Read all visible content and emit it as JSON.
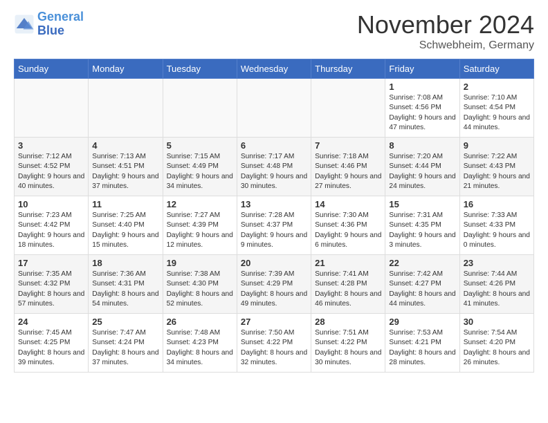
{
  "header": {
    "logo_line1": "General",
    "logo_line2": "Blue",
    "month_title": "November 2024",
    "location": "Schwebheim, Germany"
  },
  "weekdays": [
    "Sunday",
    "Monday",
    "Tuesday",
    "Wednesday",
    "Thursday",
    "Friday",
    "Saturday"
  ],
  "weeks": [
    [
      {
        "day": "",
        "info": ""
      },
      {
        "day": "",
        "info": ""
      },
      {
        "day": "",
        "info": ""
      },
      {
        "day": "",
        "info": ""
      },
      {
        "day": "",
        "info": ""
      },
      {
        "day": "1",
        "info": "Sunrise: 7:08 AM\nSunset: 4:56 PM\nDaylight: 9 hours and 47 minutes."
      },
      {
        "day": "2",
        "info": "Sunrise: 7:10 AM\nSunset: 4:54 PM\nDaylight: 9 hours and 44 minutes."
      }
    ],
    [
      {
        "day": "3",
        "info": "Sunrise: 7:12 AM\nSunset: 4:52 PM\nDaylight: 9 hours and 40 minutes."
      },
      {
        "day": "4",
        "info": "Sunrise: 7:13 AM\nSunset: 4:51 PM\nDaylight: 9 hours and 37 minutes."
      },
      {
        "day": "5",
        "info": "Sunrise: 7:15 AM\nSunset: 4:49 PM\nDaylight: 9 hours and 34 minutes."
      },
      {
        "day": "6",
        "info": "Sunrise: 7:17 AM\nSunset: 4:48 PM\nDaylight: 9 hours and 30 minutes."
      },
      {
        "day": "7",
        "info": "Sunrise: 7:18 AM\nSunset: 4:46 PM\nDaylight: 9 hours and 27 minutes."
      },
      {
        "day": "8",
        "info": "Sunrise: 7:20 AM\nSunset: 4:44 PM\nDaylight: 9 hours and 24 minutes."
      },
      {
        "day": "9",
        "info": "Sunrise: 7:22 AM\nSunset: 4:43 PM\nDaylight: 9 hours and 21 minutes."
      }
    ],
    [
      {
        "day": "10",
        "info": "Sunrise: 7:23 AM\nSunset: 4:42 PM\nDaylight: 9 hours and 18 minutes."
      },
      {
        "day": "11",
        "info": "Sunrise: 7:25 AM\nSunset: 4:40 PM\nDaylight: 9 hours and 15 minutes."
      },
      {
        "day": "12",
        "info": "Sunrise: 7:27 AM\nSunset: 4:39 PM\nDaylight: 9 hours and 12 minutes."
      },
      {
        "day": "13",
        "info": "Sunrise: 7:28 AM\nSunset: 4:37 PM\nDaylight: 9 hours and 9 minutes."
      },
      {
        "day": "14",
        "info": "Sunrise: 7:30 AM\nSunset: 4:36 PM\nDaylight: 9 hours and 6 minutes."
      },
      {
        "day": "15",
        "info": "Sunrise: 7:31 AM\nSunset: 4:35 PM\nDaylight: 9 hours and 3 minutes."
      },
      {
        "day": "16",
        "info": "Sunrise: 7:33 AM\nSunset: 4:33 PM\nDaylight: 9 hours and 0 minutes."
      }
    ],
    [
      {
        "day": "17",
        "info": "Sunrise: 7:35 AM\nSunset: 4:32 PM\nDaylight: 8 hours and 57 minutes."
      },
      {
        "day": "18",
        "info": "Sunrise: 7:36 AM\nSunset: 4:31 PM\nDaylight: 8 hours and 54 minutes."
      },
      {
        "day": "19",
        "info": "Sunrise: 7:38 AM\nSunset: 4:30 PM\nDaylight: 8 hours and 52 minutes."
      },
      {
        "day": "20",
        "info": "Sunrise: 7:39 AM\nSunset: 4:29 PM\nDaylight: 8 hours and 49 minutes."
      },
      {
        "day": "21",
        "info": "Sunrise: 7:41 AM\nSunset: 4:28 PM\nDaylight: 8 hours and 46 minutes."
      },
      {
        "day": "22",
        "info": "Sunrise: 7:42 AM\nSunset: 4:27 PM\nDaylight: 8 hours and 44 minutes."
      },
      {
        "day": "23",
        "info": "Sunrise: 7:44 AM\nSunset: 4:26 PM\nDaylight: 8 hours and 41 minutes."
      }
    ],
    [
      {
        "day": "24",
        "info": "Sunrise: 7:45 AM\nSunset: 4:25 PM\nDaylight: 8 hours and 39 minutes."
      },
      {
        "day": "25",
        "info": "Sunrise: 7:47 AM\nSunset: 4:24 PM\nDaylight: 8 hours and 37 minutes."
      },
      {
        "day": "26",
        "info": "Sunrise: 7:48 AM\nSunset: 4:23 PM\nDaylight: 8 hours and 34 minutes."
      },
      {
        "day": "27",
        "info": "Sunrise: 7:50 AM\nSunset: 4:22 PM\nDaylight: 8 hours and 32 minutes."
      },
      {
        "day": "28",
        "info": "Sunrise: 7:51 AM\nSunset: 4:22 PM\nDaylight: 8 hours and 30 minutes."
      },
      {
        "day": "29",
        "info": "Sunrise: 7:53 AM\nSunset: 4:21 PM\nDaylight: 8 hours and 28 minutes."
      },
      {
        "day": "30",
        "info": "Sunrise: 7:54 AM\nSunset: 4:20 PM\nDaylight: 8 hours and 26 minutes."
      }
    ]
  ]
}
